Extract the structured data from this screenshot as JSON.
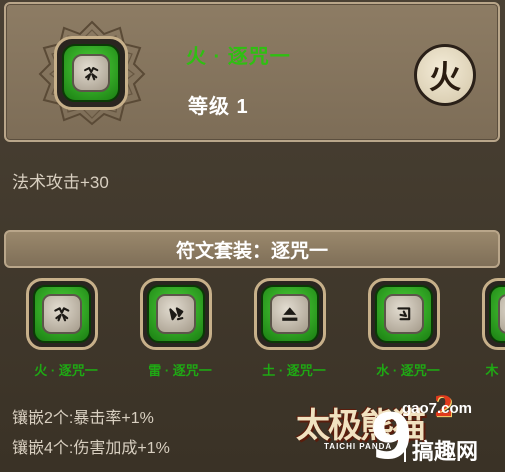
{
  "rune": {
    "name": "火 · 逐咒一",
    "level": "等级 1",
    "element_char": "火",
    "stat": "法术攻击+30"
  },
  "set": {
    "title": "符文套装：逐咒一",
    "items": [
      {
        "label": "火 · 逐咒一",
        "icon": "rune-fire-icon"
      },
      {
        "label": "雷 · 逐咒一",
        "icon": "rune-thunder-icon"
      },
      {
        "label": "土 · 逐咒一",
        "icon": "rune-earth-icon"
      },
      {
        "label": "水 · 逐咒一",
        "icon": "rune-water-icon"
      },
      {
        "label": "木",
        "icon": "rune-wood-icon"
      }
    ],
    "bonus2": "镶嵌2个:暴击率+1%",
    "bonus4": "镶嵌4个:伤害加成+1%"
  },
  "watermark": {
    "logo_text": "太极熊猫",
    "logo_number": "2",
    "logo_sub": "TAICHI PANDA",
    "url": "gao7.com",
    "big_char": "9",
    "site_name": "搞趣网"
  },
  "colors": {
    "rune_name": "#2fbf12",
    "panel": "#8d7c64",
    "background": "#3d3528"
  }
}
